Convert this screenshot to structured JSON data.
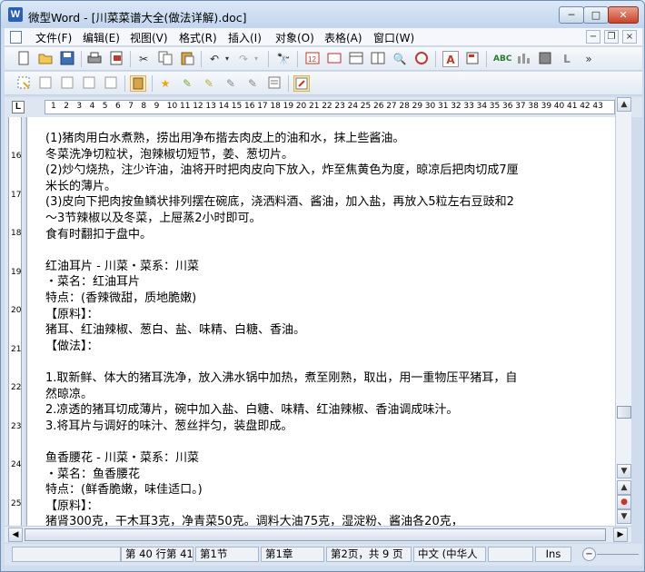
{
  "window": {
    "title": "微型Word - [川菜菜谱大全(做法详解).doc]",
    "app_icon": "W",
    "min_label": "─",
    "max_label": "□",
    "close_label": "✕"
  },
  "menu": {
    "items": [
      "文件(F)",
      "编辑(E)",
      "视图(V)",
      "格式(R)",
      "插入(I)",
      "对象(O)",
      "表格(A)",
      "窗口(W)"
    ],
    "mdi": [
      "−",
      "❐",
      "×"
    ]
  },
  "toolbar1_icons": [
    "new-icon",
    "open-icon",
    "save-icon",
    "print-icon",
    "pdf-icon",
    "cut-icon",
    "copy-icon",
    "paste-icon",
    "undo-icon",
    "redo-icon",
    "find-icon",
    "page-number-icon",
    "insert-icon",
    "table-icon",
    "columns-icon",
    "zoom-icon",
    "stop-icon",
    "font-color-icon",
    "format-icon",
    "spellcheck-icon",
    "chart-icon",
    "box-icon",
    "text-icon",
    "more-icon"
  ],
  "toolbar2_icons": [
    "select-icon",
    "edit-icon",
    "delete-icon",
    "group-icon",
    "ungroup-icon",
    "clipboard-icon",
    "star-icon",
    "marker-icon",
    "pen-icon",
    "eraser-icon",
    "brush-icon",
    "notes-icon",
    "outline-icon"
  ],
  "ruler": {
    "corner": "L",
    "numbers": [
      "1",
      "2",
      "3",
      "4",
      "5",
      "6",
      "7",
      "8",
      "9",
      "10",
      "11",
      "12",
      "13",
      "14",
      "15",
      "16",
      "17",
      "18",
      "19",
      "20",
      "21",
      "22",
      "23",
      "24",
      "25",
      "26",
      "27",
      "28",
      "29",
      "30",
      "31",
      "32",
      "33",
      "34",
      "35",
      "36",
      "37",
      "38",
      "39",
      "40",
      "41",
      "42",
      "43"
    ],
    "vnumbers": [
      "16",
      "17",
      "18",
      "19",
      "20",
      "21",
      "22",
      "23",
      "24",
      "25"
    ]
  },
  "document": {
    "lines": [
      "(1)猪肉用白水煮熟，捞出用净布揩去肉皮上的油和水，抹上些酱油。",
      "冬菜洗净切粒状，泡辣椒切短节，姜、葱切片。",
      "(2)炒勺烧热，注少许油，油将开时把肉皮向下放入，炸至焦黄色为度，晾凉后把肉切成7厘",
      "米长的薄片。",
      "(3)皮向下把肉按鱼鳞状排列摆在碗底，浇洒料酒、酱油，加入盐，再放入5粒左右豆豉和2",
      "～3节辣椒以及冬菜，上屉蒸2小时即可。",
      "食有时翻扣于盘中。",
      "",
      "红油耳片 - 川菜・菜系：川菜",
      "・菜名：红油耳片",
      "   特点：(香辣微甜，质地脆嫩)",
      "【原料】：",
      "猪耳、红油辣椒、葱白、盐、味精、白糖、香油。",
      "【做法】：",
      "",
      "1.取新鲜、体大的猪耳洗净，放入沸水锅中加热，煮至刚熟，取出，用一重物压平猪耳，自",
      "然晾凉。",
      "2.凉透的猪耳切成薄片，碗中加入盐、白糖、味精、红油辣椒、香油调成味汁。",
      "3.将耳片与调好的味汁、葱丝拌匀，装盘即成。",
      "",
      "鱼香腰花 - 川菜・菜系：川菜",
      "・菜名：鱼香腰花",
      "   特点：(鲜香脆嫩，味佳适口。)",
      "【原料】：",
      "猪肾300克，干木耳3克，净青菜50克。调料大油75克，湿淀粉、酱油各20克，"
    ]
  },
  "status": {
    "position": "第 40 行第 41",
    "section": "第1节",
    "chapter": "第1章",
    "page": "第2页，共 9 页",
    "language": "中文 (中华人",
    "mode": "Ins"
  }
}
